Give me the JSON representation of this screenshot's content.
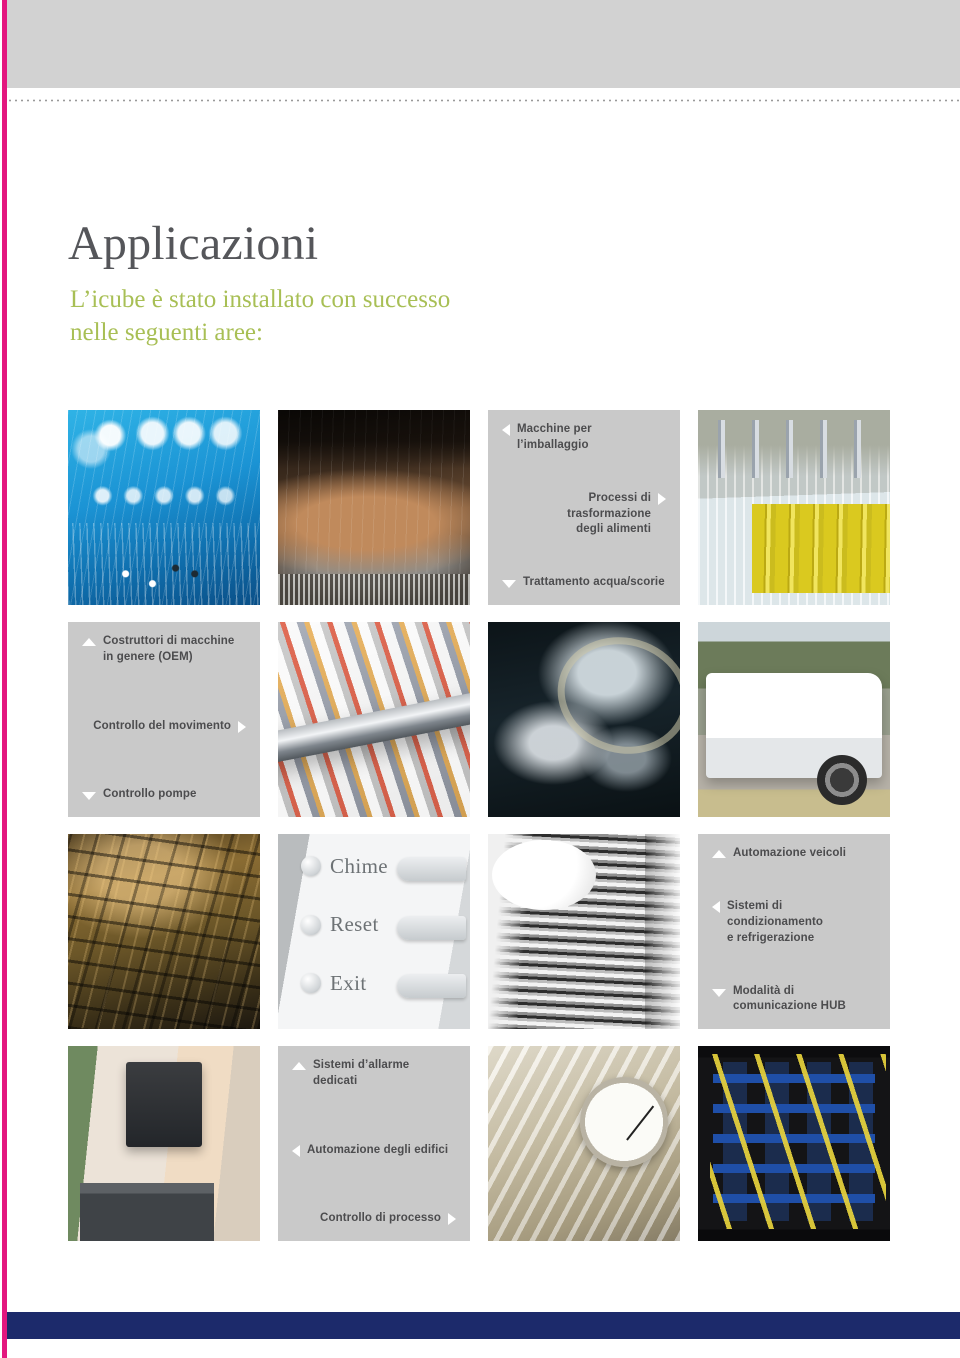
{
  "page": {
    "title": "Applicazioni",
    "subtitle": "L’icube è stato installato con successo nelle seguenti aree:"
  },
  "colors": {
    "edge_bar": "#e3177f",
    "top_band": "#d2d2d2",
    "bottom_bar": "#1c2a6b",
    "title": "#55565a",
    "subtitle": "#a8bf55",
    "label_cell_bg": "#c9c9c9",
    "label_text": "#4c4c4e",
    "marker": "#ffffff"
  },
  "grid": {
    "columns": 4,
    "rows": 4,
    "cells": [
      {
        "kind": "photo",
        "name": "circuit-board-photo",
        "style": "ph-circuit"
      },
      {
        "kind": "photo",
        "name": "food-conveyor-photo",
        "style": "ph-conveyor"
      },
      {
        "kind": "label",
        "name": "label-cell-packaging",
        "labels": [
          {
            "text": "Macchine per l’imballaggio",
            "marker": "left",
            "align": "left"
          },
          {
            "text": "Processi di trasformazione\ndegli alimenti",
            "marker": "right",
            "align": "right"
          },
          {
            "text": "Trattamento acqua/scorie",
            "marker": "down",
            "align": "left"
          }
        ]
      },
      {
        "kind": "photo",
        "name": "bottling-line-photo",
        "style": "ph-bottling"
      },
      {
        "kind": "label",
        "name": "label-cell-oem",
        "labels": [
          {
            "text": "Costruttori di macchine\nin genere (OEM)",
            "marker": "up",
            "align": "left"
          },
          {
            "text": "Controllo del movimento",
            "marker": "right",
            "align": "right"
          },
          {
            "text": "Controllo pompe",
            "marker": "down",
            "align": "left"
          }
        ]
      },
      {
        "kind": "photo",
        "name": "printing-press-photo",
        "style": "ph-press"
      },
      {
        "kind": "photo",
        "name": "water-treatment-photo",
        "style": "ph-water"
      },
      {
        "kind": "photo",
        "name": "utility-van-photo",
        "style": "ph-van"
      },
      {
        "kind": "photo",
        "name": "industrial-piping-photo",
        "style": "ph-piping"
      },
      {
        "kind": "photo",
        "name": "alarm-keypad-photo",
        "style": "ph-keypad",
        "keys": [
          "Chime",
          "Reset",
          "Exit"
        ]
      },
      {
        "kind": "photo",
        "name": "hvac-fins-photo",
        "style": "ph-fins"
      },
      {
        "kind": "label",
        "name": "label-cell-vehicles",
        "labels": [
          {
            "text": "Automazione veicoli",
            "marker": "up",
            "align": "left"
          },
          {
            "text": "Sistemi di condizionamento\ne refrigerazione",
            "marker": "left",
            "align": "left"
          },
          {
            "text": "Modalità di\ncomunicazione HUB",
            "marker": "down",
            "align": "left"
          }
        ]
      },
      {
        "kind": "photo",
        "name": "office-reception-photo",
        "style": "ph-office"
      },
      {
        "kind": "label",
        "name": "label-cell-buildings",
        "labels": [
          {
            "text": "Sistemi d’allarme dedicati",
            "marker": "up",
            "align": "left"
          },
          {
            "text": "Automazione degli edifici",
            "marker": "left",
            "align": "left"
          },
          {
            "text": "Controllo di processo",
            "marker": "right",
            "align": "right"
          }
        ]
      },
      {
        "kind": "photo",
        "name": "pressure-gauge-photo",
        "style": "ph-gauge"
      },
      {
        "kind": "photo",
        "name": "network-patch-panel-photo",
        "style": "ph-network"
      }
    ]
  }
}
